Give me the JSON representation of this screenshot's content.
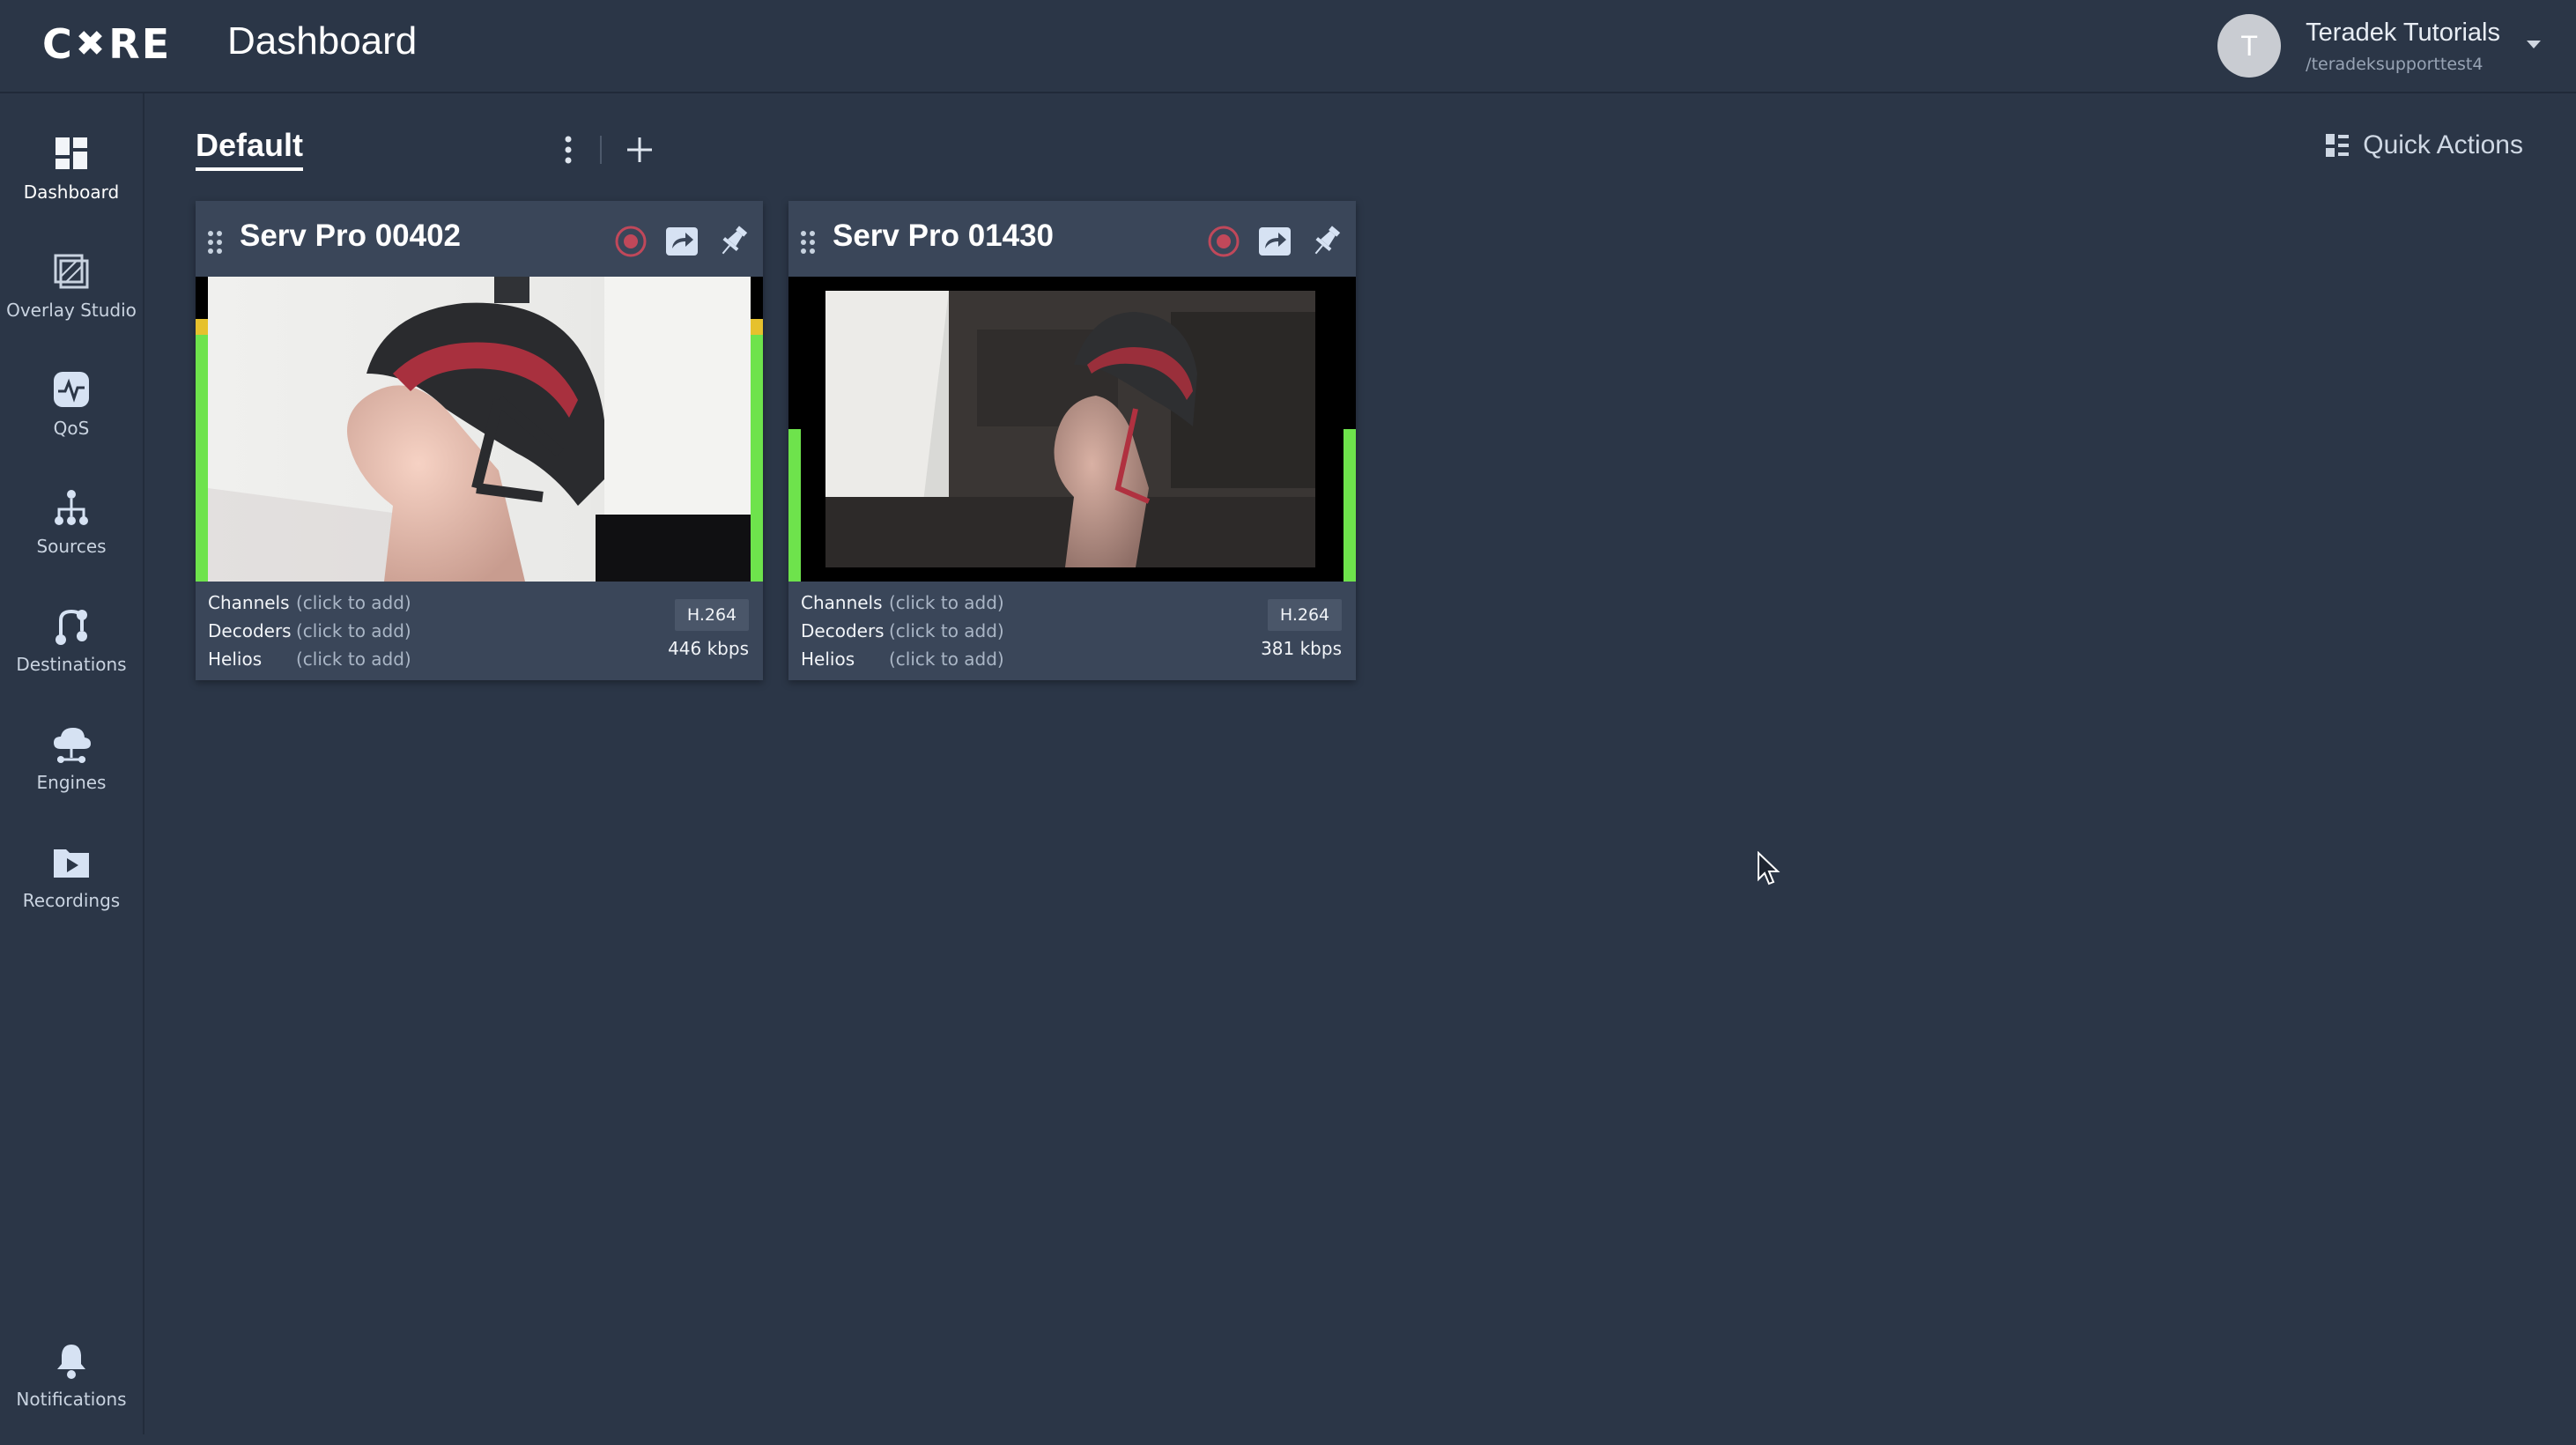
{
  "app": {
    "logo_left": "C",
    "logo_right": "RE",
    "title": "Dashboard"
  },
  "user": {
    "initial": "T",
    "name": "Teradek Tutorials",
    "path": "/teradeksupporttest4"
  },
  "sidebar": {
    "items": [
      {
        "label": "Dashboard",
        "icon": "dashboard-icon"
      },
      {
        "label": "Overlay Studio",
        "icon": "overlay-studio-icon"
      },
      {
        "label": "QoS",
        "icon": "qos-icon"
      },
      {
        "label": "Sources",
        "icon": "sources-icon"
      },
      {
        "label": "Destinations",
        "icon": "destinations-icon"
      },
      {
        "label": "Engines",
        "icon": "engines-icon"
      },
      {
        "label": "Recordings",
        "icon": "recordings-icon"
      }
    ],
    "notifications_label": "Notifications"
  },
  "main": {
    "tab_label": "Default",
    "quick_actions_label": "Quick Actions"
  },
  "cards": [
    {
      "title": "Serv Pro 00402",
      "channels_label": "Channels",
      "channels_value": "(click to add)",
      "decoders_label": "Decoders",
      "decoders_value": "(click to add)",
      "helios_label": "Helios",
      "helios_value": "(click to add)",
      "codec": "H.264",
      "bitrate": "446 kbps",
      "audio_level_left": 0.82,
      "audio_level_right": 0.82
    },
    {
      "title": "Serv Pro 01430",
      "channels_label": "Channels",
      "channels_value": "(click to add)",
      "decoders_label": "Decoders",
      "decoders_value": "(click to add)",
      "helios_label": "Helios",
      "helios_value": "(click to add)",
      "codec": "H.264",
      "bitrate": "381 kbps",
      "audio_level_left": 0.5,
      "audio_level_right": 0.5
    }
  ],
  "colors": {
    "background": "#2b3647",
    "card": "#3a4659",
    "meter_green": "#6ee34c",
    "meter_yellow": "#e6c12d",
    "record_red": "#c0485a",
    "icon_blue": "#d6e2f3"
  }
}
